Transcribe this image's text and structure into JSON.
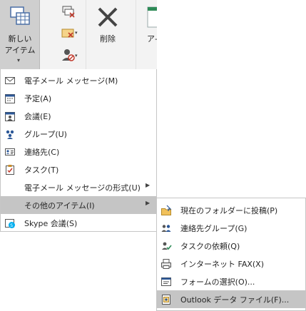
{
  "ribbon": {
    "new_item_label_line1": "新しい",
    "new_item_label_line2": "アイテム",
    "delete_label": "削除",
    "next_group_label": "ア-"
  },
  "menu": {
    "items": [
      {
        "label": "電子メール メッセージ(M)",
        "icon": "mail-message-icon"
      },
      {
        "label": "予定(A)",
        "icon": "appointment-icon"
      },
      {
        "label": "会議(E)",
        "icon": "meeting-icon"
      },
      {
        "label": "グループ(U)",
        "icon": "group-icon"
      },
      {
        "label": "連絡先(C)",
        "icon": "contact-icon"
      },
      {
        "label": "タスク(T)",
        "icon": "task-icon"
      },
      {
        "label": "電子メール メッセージの形式(U)",
        "icon": ""
      },
      {
        "label": "その他のアイテム(I)",
        "icon": ""
      },
      {
        "label": "Skype 会議(S)",
        "icon": "skype-icon"
      }
    ]
  },
  "submenu": {
    "items": [
      {
        "label": "現在のフォルダーに投稿(P)",
        "icon": "post-to-folder-icon"
      },
      {
        "label": "連絡先グループ(G)",
        "icon": "contact-group-icon"
      },
      {
        "label": "タスクの依頼(Q)",
        "icon": "task-request-icon"
      },
      {
        "label": "インターネット FAX(X)",
        "icon": "internet-fax-icon"
      },
      {
        "label": "フォームの選択(O)...",
        "icon": "choose-form-icon"
      },
      {
        "label": "Outlook データ ファイル(F)...",
        "icon": "outlook-data-file-icon"
      }
    ]
  },
  "colors": {
    "highlight": "#c5c5c5",
    "ribbon_bg": "#f3f3f3",
    "accent_blue": "#2b5797",
    "accent_red": "#c0392b"
  }
}
